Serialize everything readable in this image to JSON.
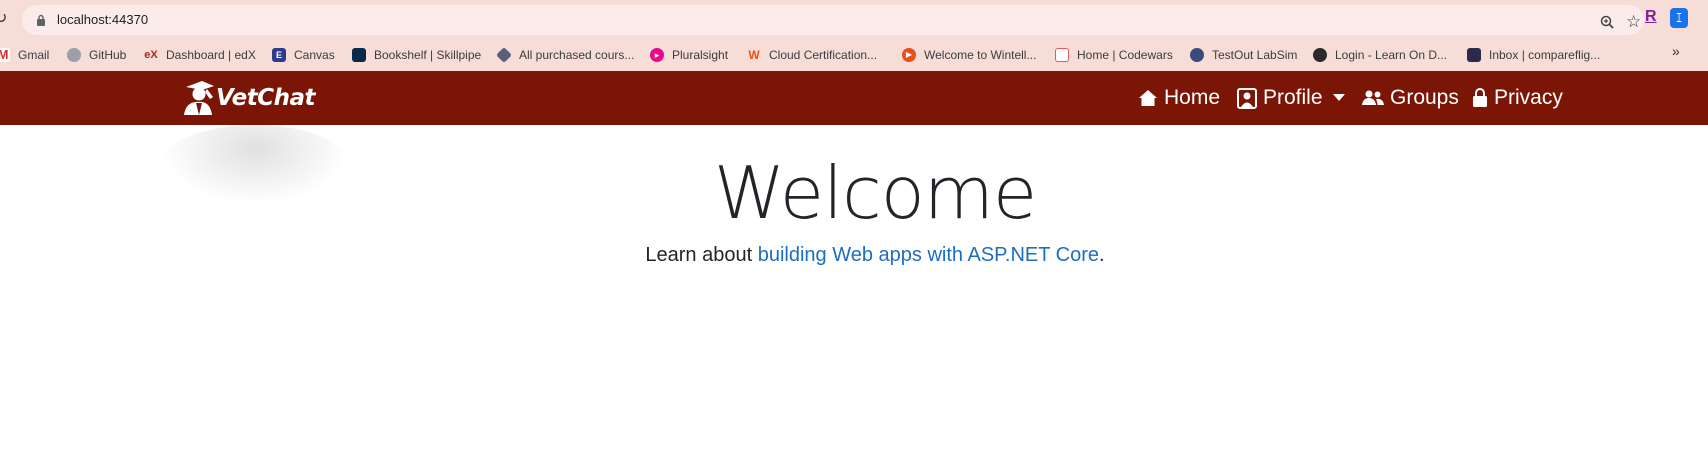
{
  "browser": {
    "url": "localhost:44370",
    "bookmarks": [
      {
        "label": "Gmail",
        "icon": "gmail-icon",
        "color": "#d93025"
      },
      {
        "label": "GitHub",
        "icon": "github-icon",
        "color": "#9aa0a6"
      },
      {
        "label": "Dashboard | edX",
        "icon": "edx-icon",
        "color": "#b3261e"
      },
      {
        "label": "Canvas",
        "icon": "canvas-icon",
        "color": "#2d3b8e"
      },
      {
        "label": "Bookshelf | Skillpipe",
        "icon": "skillpipe-icon",
        "color": "#0b2a4a"
      },
      {
        "label": "All purchased cours...",
        "icon": "udemy-icon",
        "color": "#5b5f7a"
      },
      {
        "label": "Pluralsight",
        "icon": "pluralsight-icon",
        "color": "#e80a89"
      },
      {
        "label": "Cloud Certification...",
        "icon": "acloudguru-icon",
        "color": "#e8531a"
      },
      {
        "label": "Welcome to Wintell...",
        "icon": "wintellect-icon",
        "color": "#e84e1b"
      },
      {
        "label": "Home | Codewars",
        "icon": "codewars-icon",
        "color": "#e05a5a"
      },
      {
        "label": "TestOut LabSim",
        "icon": "testout-icon",
        "color": "#3a4a7a"
      },
      {
        "label": "Login - Learn On D...",
        "icon": "globe-icon",
        "color": "#2b2b2b"
      },
      {
        "label": "Inbox | compareflig...",
        "icon": "inbox-icon",
        "color": "#2a2a4a"
      }
    ],
    "ext_r": "R",
    "ext_b": "ꕯ"
  },
  "navbar": {
    "brand": "VetChat",
    "items": [
      {
        "label": "Home",
        "icon": "home-icon"
      },
      {
        "label": "Profile",
        "icon": "profile-icon"
      },
      {
        "label": "Groups",
        "icon": "groups-icon"
      },
      {
        "label": "Privacy",
        "icon": "lock-icon"
      }
    ]
  },
  "main": {
    "heading": "Welcome",
    "lead_prefix": "Learn about ",
    "lead_link": "building Web apps with ASP.NET Core",
    "lead_suffix": "."
  },
  "colors": {
    "navbar_bg": "#7b1505",
    "chrome_bg": "#f6ddd8",
    "link": "#1b6ec2"
  }
}
